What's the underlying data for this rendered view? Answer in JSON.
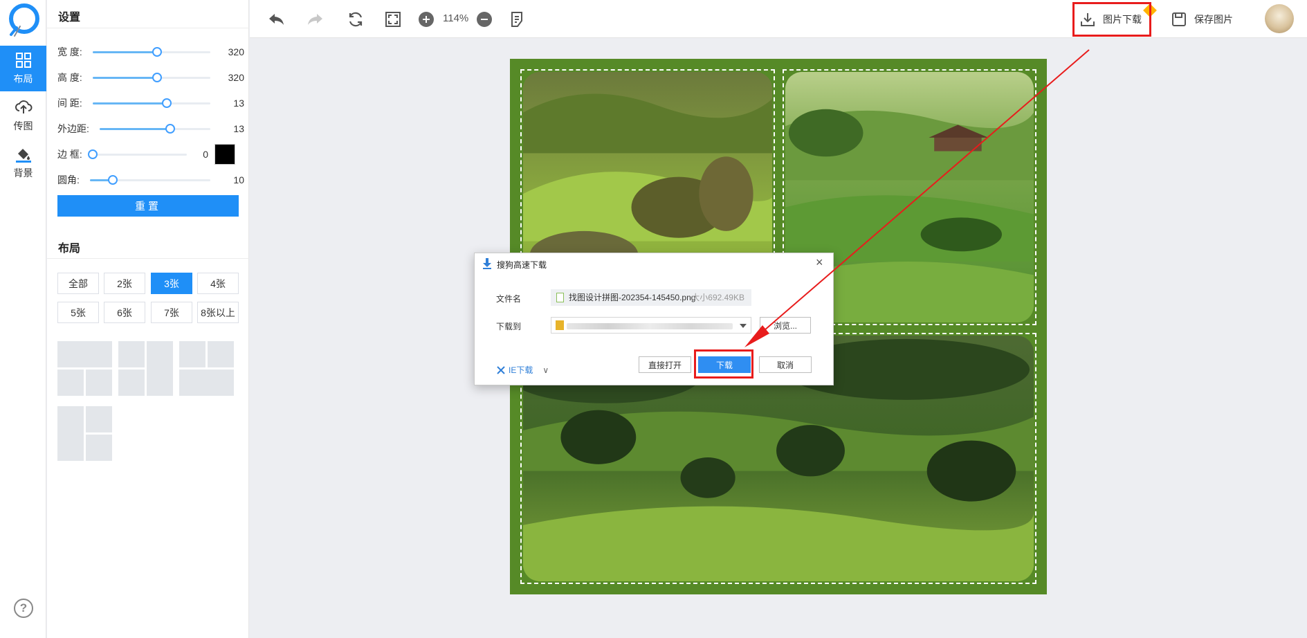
{
  "app": {
    "rail": {
      "items": [
        {
          "label": "布局",
          "icon": "layout-grid-icon",
          "active": true
        },
        {
          "label": "传图",
          "icon": "cloud-upload-icon",
          "active": false
        },
        {
          "label": "背景",
          "icon": "paint-bucket-icon",
          "active": false
        }
      ],
      "help_label": "?"
    },
    "settings": {
      "title": "设置",
      "rows": [
        {
          "label": "宽 度:",
          "value": "320",
          "level": 0.55
        },
        {
          "label": "高 度:",
          "value": "320",
          "level": 0.55
        },
        {
          "label": "间 距:",
          "value": "13",
          "level": 0.6
        },
        {
          "label": "外边距:",
          "value": "13",
          "level": 0.6
        },
        {
          "label": "边 框:",
          "value": "0",
          "level": 0.0
        },
        {
          "label": "圆角:",
          "value": "10",
          "level": 0.2
        }
      ],
      "border_color": "#000000",
      "reset_label": "重置"
    },
    "layout": {
      "title": "布局",
      "buttons": [
        "全部",
        "2张",
        "3张",
        "4张",
        "5张",
        "6张",
        "7张",
        "8张以上"
      ],
      "active_button": "3张"
    },
    "toolbar": {
      "zoom": "114%",
      "download_label": "图片下载",
      "save_label": "保存图片"
    },
    "dialog": {
      "title": "搜狗高速下载",
      "close": "×",
      "filename_label": "文件名",
      "filename": "找图设计拼图-202354-145450.png",
      "filesize": "大小692.49KB",
      "save_to_label": "下载到",
      "browse_label": "浏览...",
      "ie_label": "IE下载",
      "open_label": "直接打开",
      "download_label": "下载",
      "cancel_label": "取消"
    },
    "colors": {
      "accent": "#1f8ff7",
      "canvas_bg": "#568a27",
      "annotation": "#e81c1c"
    }
  }
}
